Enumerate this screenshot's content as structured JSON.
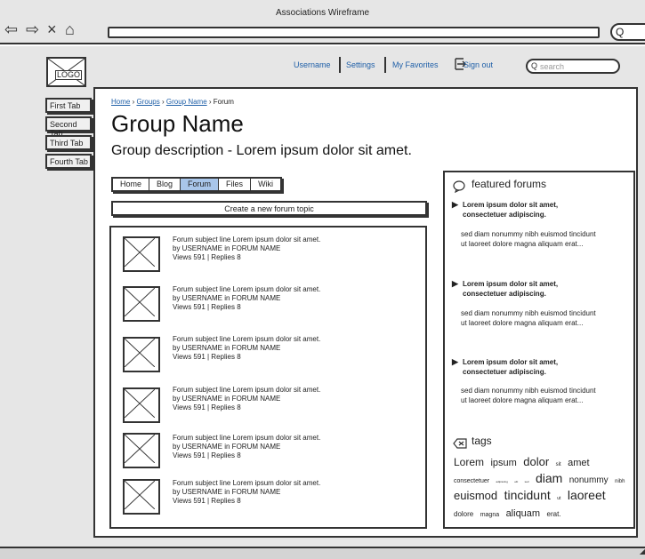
{
  "window": {
    "title": "Associations Wireframe"
  },
  "browser": {
    "back": "⇦",
    "forward": "⇨",
    "close": "×",
    "home": "⌂",
    "search_glyph": "Q"
  },
  "logo": {
    "label": "LOGO"
  },
  "side_tabs": [
    "First Tab",
    "Second Tab",
    "Third Tab",
    "Fourth Tab"
  ],
  "top_links": {
    "username": "Username",
    "settings": "Settings",
    "favorites": "My Favorites",
    "signout": "Sign out",
    "search_placeholder": "search"
  },
  "breadcrumb": {
    "home": "Home",
    "sep1": "›",
    "groups": "Groups",
    "sep2": "›",
    "group_name": "Group Name",
    "sep3": "›",
    "current": "Forum"
  },
  "page": {
    "title": "Group Name",
    "description": "Group description - Lorem ipsum dolor sit amet."
  },
  "group_tabs": [
    {
      "label": "Home",
      "active": false
    },
    {
      "label": "Blog",
      "active": false
    },
    {
      "label": "Forum",
      "active": true
    },
    {
      "label": "Files",
      "active": false
    },
    {
      "label": "Wiki",
      "active": false
    }
  ],
  "create_topic_label": "Create a new forum topic",
  "topics": [
    {
      "subject": "Forum subject line Lorem ipsum dolor sit amet.",
      "by": "by USERNAME in FORUM NAME",
      "stats": "Views 591 | Replies 8"
    },
    {
      "subject": "Forum subject line Lorem ipsum dolor sit amet.",
      "by": "by USERNAME in FORUM NAME",
      "stats": "Views 591 | Replies 8"
    },
    {
      "subject": "Forum subject line Lorem ipsum dolor sit amet.",
      "by": "by USERNAME in FORUM NAME",
      "stats": "Views 591 | Replies 8"
    },
    {
      "subject": "Forum subject line Lorem ipsum dolor sit amet.",
      "by": "by USERNAME in FORUM NAME",
      "stats": "Views 591 | Replies 8"
    },
    {
      "subject": "Forum subject line Lorem ipsum dolor sit amet.",
      "by": "by USERNAME in FORUM NAME",
      "stats": "Views 591 | Replies 8"
    },
    {
      "subject": "Forum subject line Lorem ipsum dolor sit amet.",
      "by": "by USERNAME in FORUM NAME",
      "stats": "Views 591 | Replies 8"
    }
  ],
  "featured": {
    "heading": "featured forums",
    "items": [
      {
        "title": "Lorem ipsum dolor sit amet, consectetuer adipiscing.",
        "body": "sed diam nonummy nibh euismod tincidunt ut laoreet dolore magna aliquam erat..."
      },
      {
        "title": "Lorem ipsum dolor sit amet, consectetuer adipiscing.",
        "body": "sed diam nonummy nibh euismod tincidunt ut laoreet dolore magna aliquam erat..."
      },
      {
        "title": "Lorem ipsum dolor sit amet, consectetuer adipiscing.",
        "body": "sed diam nonummy nibh euismod tincidunt ut laoreet dolore magna aliquam erat..."
      }
    ]
  },
  "tags": {
    "heading": "tags",
    "words": [
      {
        "text": "Lorem",
        "size": 12
      },
      {
        "text": "ipsum",
        "size": 11
      },
      {
        "text": "dolor",
        "size": 13
      },
      {
        "text": "sit",
        "size": 6
      },
      {
        "text": "amet",
        "size": 11
      },
      {
        "text": "consectetuer",
        "size": 7
      },
      {
        "text": "adipiscing",
        "size": 3
      },
      {
        "text": "elit",
        "size": 3
      },
      {
        "text": "sed",
        "size": 3
      },
      {
        "text": "diam",
        "size": 14
      },
      {
        "text": "nonummy",
        "size": 10
      },
      {
        "text": "nibh",
        "size": 6
      },
      {
        "text": "euismod",
        "size": 13
      },
      {
        "text": "tincidunt",
        "size": 14
      },
      {
        "text": "ut",
        "size": 5
      },
      {
        "text": "laoreet",
        "size": 14
      },
      {
        "text": "dolore",
        "size": 8
      },
      {
        "text": "magna",
        "size": 7
      },
      {
        "text": "aliquam",
        "size": 11
      },
      {
        "text": "erat.",
        "size": 8
      }
    ]
  },
  "colors": {
    "link": "#2060a8",
    "active_tab": "#a9c6ea",
    "chrome": "#e6e6e6"
  }
}
